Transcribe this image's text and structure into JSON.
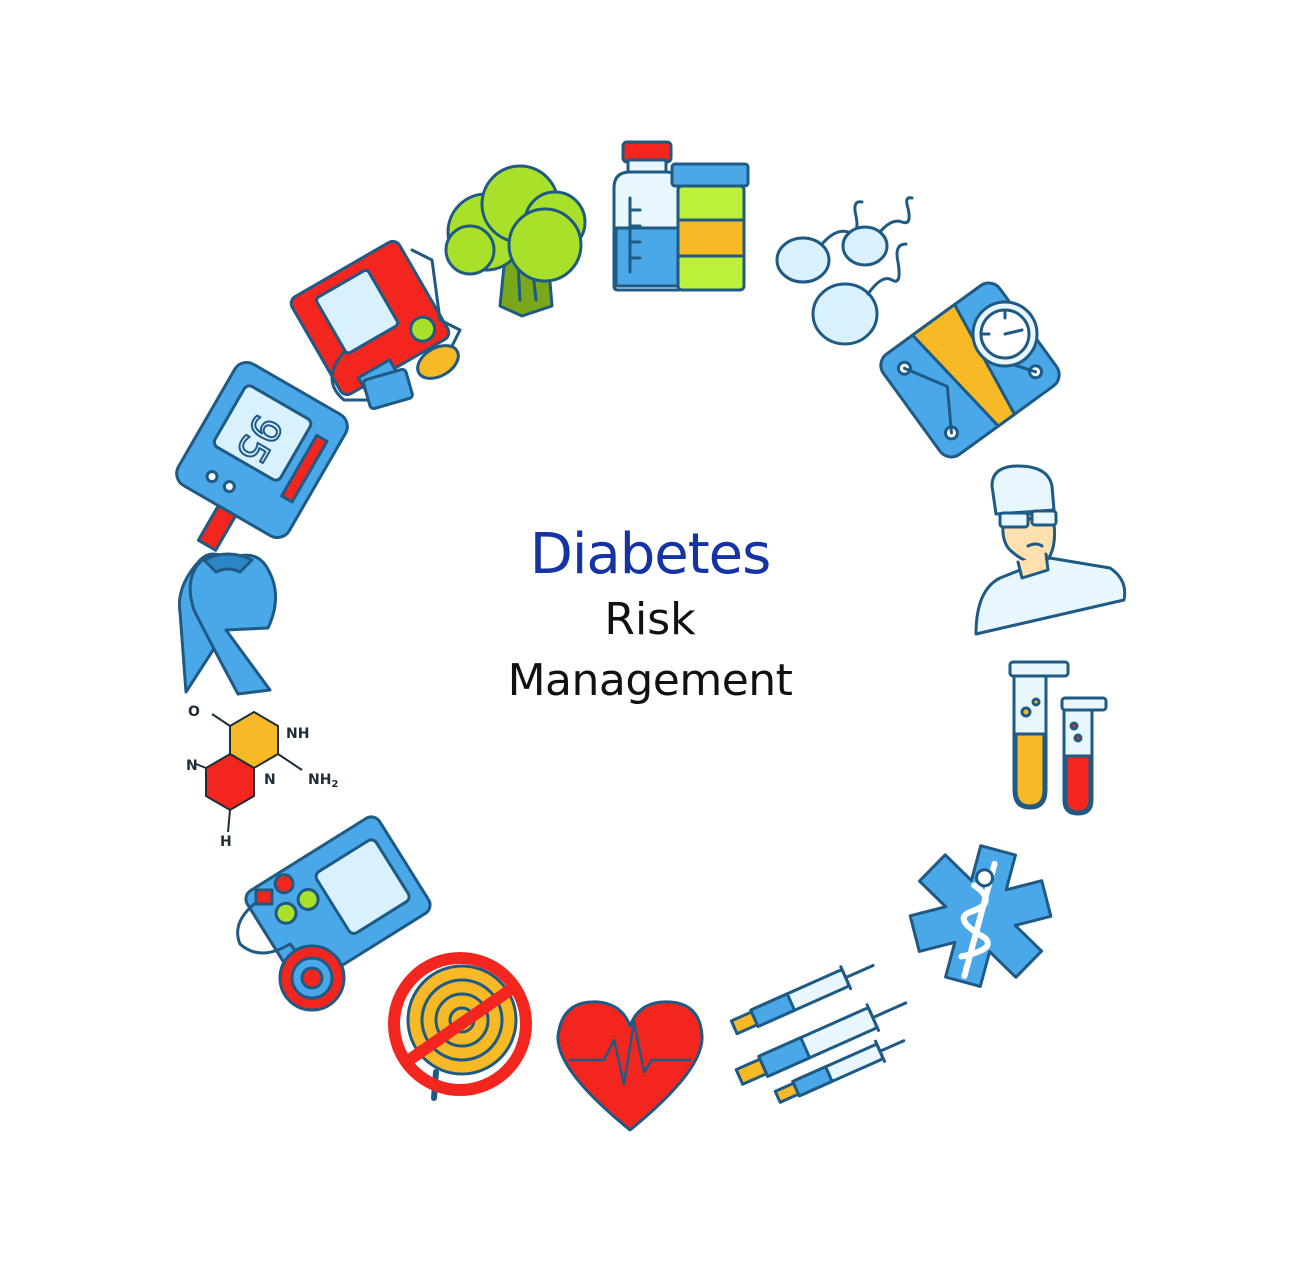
{
  "title": {
    "line1": "Diabetes",
    "line2": "Risk",
    "line3": "Management"
  },
  "molecule": {
    "o": "O",
    "nh": "NH",
    "nh2": "NH",
    "nh2_sub": "2",
    "n_left": "N",
    "n_mid": "N",
    "h": "H"
  },
  "glucometer": {
    "reading": "95"
  },
  "colors": {
    "title_accent": "#1533a3",
    "text": "#111111",
    "outline": "#1e5a84",
    "blue": "#4aa8e8",
    "light_blue": "#d9f1fd",
    "red": "#f2261e",
    "yellow": "#f7b926",
    "green": "#a8e02a"
  },
  "icons": [
    "sample-bottles-icon",
    "sperm-icon",
    "scale-icon",
    "doctor-icon",
    "test-tubes-icon",
    "star-of-life-icon",
    "syringes-icon",
    "heart-icon",
    "no-sweets-icon",
    "insulin-pump-icon",
    "molecule-icon",
    "ribbon-icon",
    "glucometer-icon",
    "blood-pressure-monitor-icon",
    "broccoli-icon"
  ]
}
